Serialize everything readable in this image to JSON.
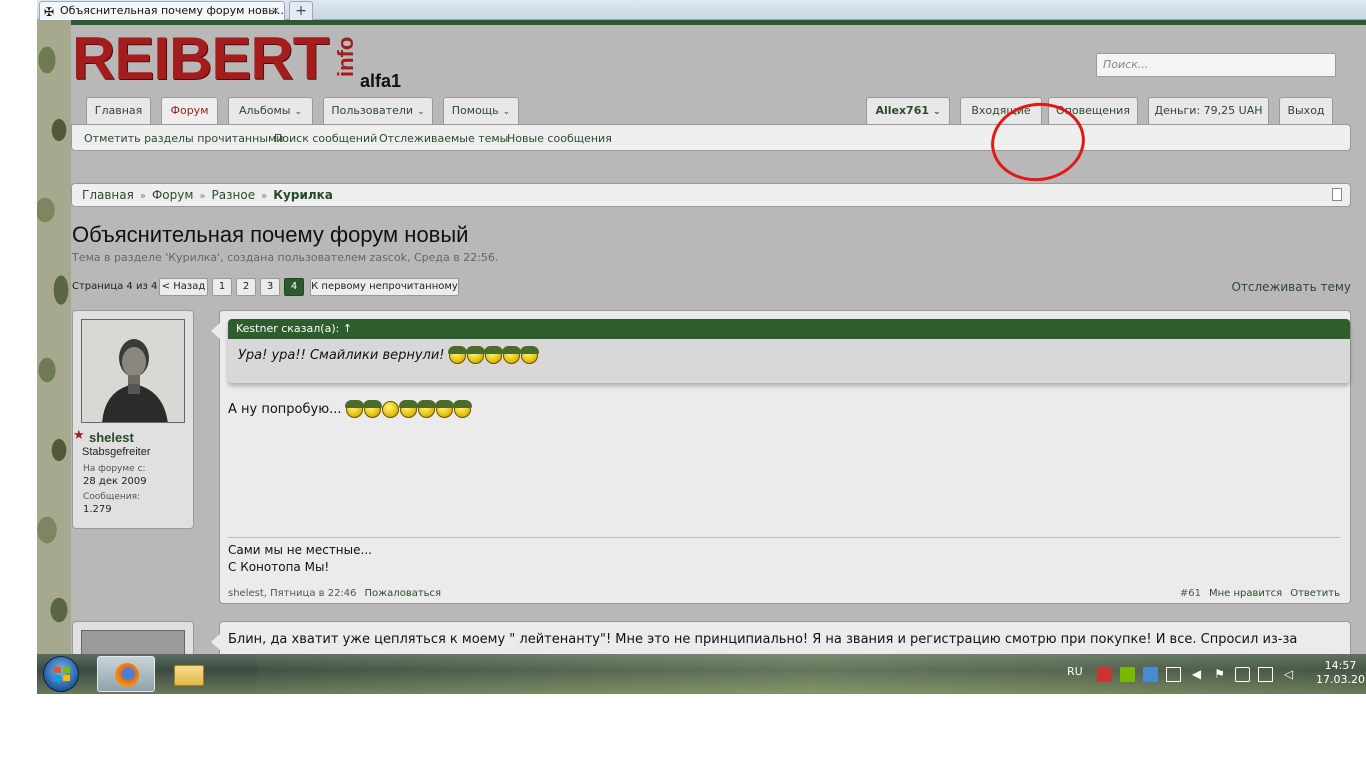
{
  "browser": {
    "tab_title": "Объяснительная почему форум новы...",
    "new_tab": "+",
    "close": "×",
    "favicon": "✠"
  },
  "site": {
    "logo": "REIBERT",
    "logo_info": "info",
    "logo_sub": "alfa1",
    "search_placeholder": "Поиск..."
  },
  "nav": {
    "left_tabs": [
      {
        "label": "Главная"
      },
      {
        "label": "Форум"
      },
      {
        "label": "Альбомы"
      },
      {
        "label": "Пользователи"
      },
      {
        "label": "Помощь"
      }
    ],
    "right_tabs": [
      {
        "label": "Allex761"
      },
      {
        "label": "Входящие"
      },
      {
        "label": "Оповещения"
      },
      {
        "label": "Деньги: 79,25 UAH"
      },
      {
        "label": "Выход"
      }
    ],
    "chevron": "⌄",
    "sub_links": [
      "Отметить разделы прочитанными",
      "Поиск сообщений",
      "Отслеживаемые темы",
      "Новые сообщения"
    ]
  },
  "breadcrumb": {
    "items": [
      "Главная",
      "Форум",
      "Разное"
    ],
    "current": "Курилка",
    "sep": "»"
  },
  "thread": {
    "title": "Объяснительная почему форум новый",
    "description": "Тема в разделе 'Курилка', создана пользователем zascok, Среда в 22:56.",
    "watch": "Отслеживать тему"
  },
  "pager": {
    "label": "Страница 4 из 4",
    "prev": "< Назад",
    "pages": [
      "1",
      "2",
      "3",
      "4"
    ],
    "current": "4",
    "first_unread": "К первому непрочитанному"
  },
  "post": {
    "user": {
      "name": "shelest",
      "rank": "Stabsgefreiter",
      "joined_label": "На форуме с:",
      "joined": "28 дек 2009",
      "messages_label": "Сообщения:",
      "messages": "1.279",
      "star": "★"
    },
    "quote_header": "Kestner сказал(а): ↑",
    "quote_text": "Ура! ура!! Смайлики вернули!",
    "body": "А ну попробую...",
    "signature": [
      "Сами мы не местные...",
      "С Конотопа Мы!"
    ],
    "meta": "shelest, Пятница в 22:46",
    "report": "Пожаловаться",
    "number": "#61",
    "like": "Мне нравится",
    "reply": "Ответить"
  },
  "post2": {
    "body": "Блин, да хватит уже цепляться к моему \" лейтенанту\"! Мне это не принципиально! Я на звания и регистрацию смотрю при покупке! И все. Спросил из-за"
  },
  "taskbar": {
    "lang": "RU",
    "time": "14:57",
    "date": "17.03.20"
  }
}
